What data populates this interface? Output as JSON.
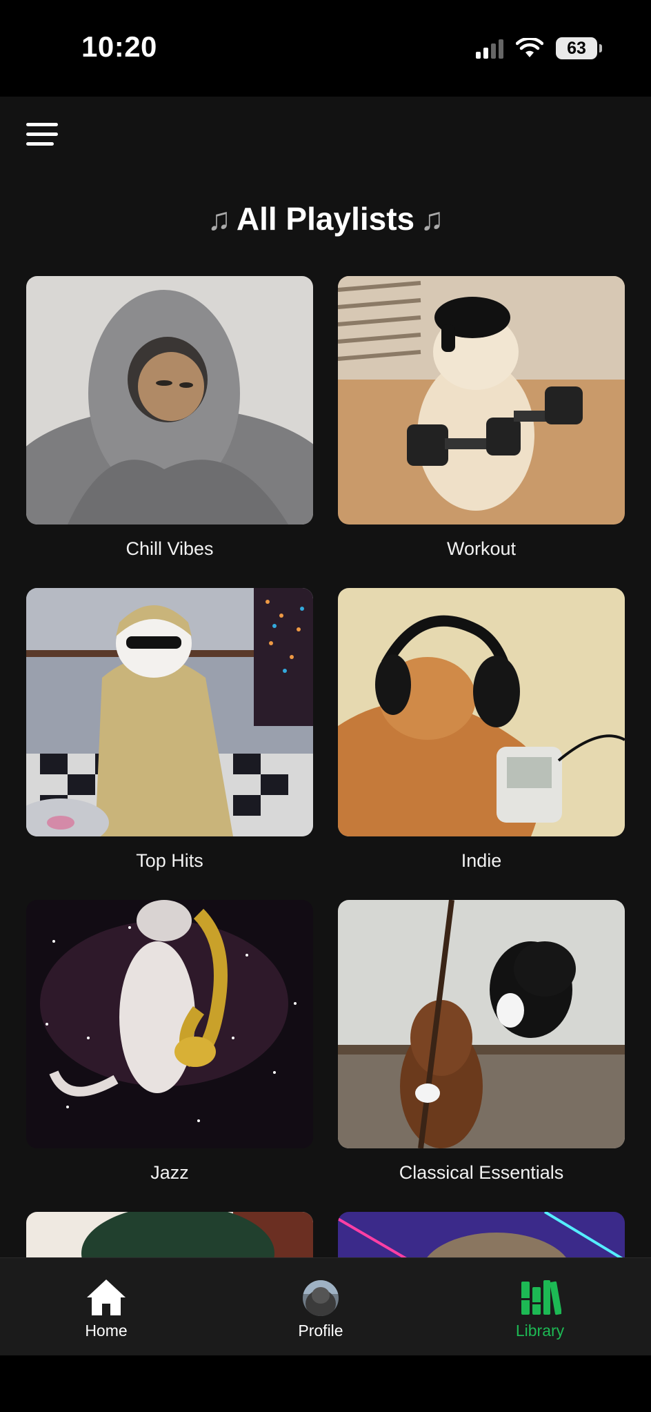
{
  "status_bar": {
    "time": "10:20",
    "battery": "63"
  },
  "header": {
    "title": "All Playlists",
    "title_icon": "musical-note"
  },
  "playlists": [
    {
      "label": "Chill Vibes"
    },
    {
      "label": "Workout"
    },
    {
      "label": "Top Hits"
    },
    {
      "label": "Indie"
    },
    {
      "label": "Jazz"
    },
    {
      "label": "Classical Essentials"
    },
    {
      "label": ""
    },
    {
      "label": ""
    }
  ],
  "bottom_nav": {
    "items": [
      {
        "label": "Home",
        "icon": "house-icon"
      },
      {
        "label": "Profile",
        "icon": "avatar"
      },
      {
        "label": "Library",
        "icon": "library-icon",
        "active": true
      }
    ]
  },
  "colors": {
    "accent": "#1db954",
    "background": "#121212",
    "nav_background": "#1b1b1b"
  }
}
